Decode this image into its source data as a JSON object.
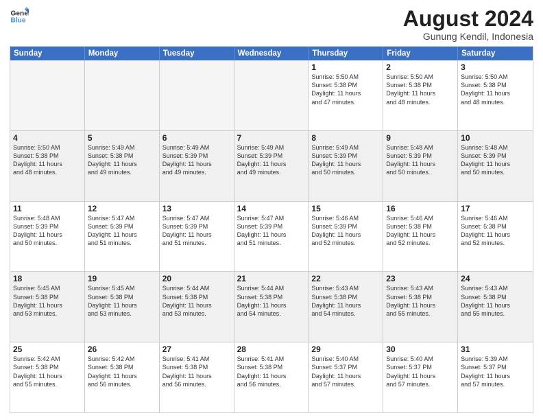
{
  "logo": {
    "line1": "General",
    "line2": "Blue"
  },
  "title": "August 2024",
  "location": "Gunung Kendil, Indonesia",
  "days_of_week": [
    "Sunday",
    "Monday",
    "Tuesday",
    "Wednesday",
    "Thursday",
    "Friday",
    "Saturday"
  ],
  "weeks": [
    [
      {
        "day": "",
        "info": "",
        "empty": true
      },
      {
        "day": "",
        "info": "",
        "empty": true
      },
      {
        "day": "",
        "info": "",
        "empty": true
      },
      {
        "day": "",
        "info": "",
        "empty": true
      },
      {
        "day": "1",
        "info": "Sunrise: 5:50 AM\nSunset: 5:38 PM\nDaylight: 11 hours\nand 47 minutes.",
        "empty": false
      },
      {
        "day": "2",
        "info": "Sunrise: 5:50 AM\nSunset: 5:38 PM\nDaylight: 11 hours\nand 48 minutes.",
        "empty": false
      },
      {
        "day": "3",
        "info": "Sunrise: 5:50 AM\nSunset: 5:38 PM\nDaylight: 11 hours\nand 48 minutes.",
        "empty": false
      }
    ],
    [
      {
        "day": "4",
        "info": "Sunrise: 5:50 AM\nSunset: 5:38 PM\nDaylight: 11 hours\nand 48 minutes.",
        "empty": false
      },
      {
        "day": "5",
        "info": "Sunrise: 5:49 AM\nSunset: 5:38 PM\nDaylight: 11 hours\nand 49 minutes.",
        "empty": false
      },
      {
        "day": "6",
        "info": "Sunrise: 5:49 AM\nSunset: 5:39 PM\nDaylight: 11 hours\nand 49 minutes.",
        "empty": false
      },
      {
        "day": "7",
        "info": "Sunrise: 5:49 AM\nSunset: 5:39 PM\nDaylight: 11 hours\nand 49 minutes.",
        "empty": false
      },
      {
        "day": "8",
        "info": "Sunrise: 5:49 AM\nSunset: 5:39 PM\nDaylight: 11 hours\nand 50 minutes.",
        "empty": false
      },
      {
        "day": "9",
        "info": "Sunrise: 5:48 AM\nSunset: 5:39 PM\nDaylight: 11 hours\nand 50 minutes.",
        "empty": false
      },
      {
        "day": "10",
        "info": "Sunrise: 5:48 AM\nSunset: 5:39 PM\nDaylight: 11 hours\nand 50 minutes.",
        "empty": false
      }
    ],
    [
      {
        "day": "11",
        "info": "Sunrise: 5:48 AM\nSunset: 5:39 PM\nDaylight: 11 hours\nand 50 minutes.",
        "empty": false
      },
      {
        "day": "12",
        "info": "Sunrise: 5:47 AM\nSunset: 5:39 PM\nDaylight: 11 hours\nand 51 minutes.",
        "empty": false
      },
      {
        "day": "13",
        "info": "Sunrise: 5:47 AM\nSunset: 5:39 PM\nDaylight: 11 hours\nand 51 minutes.",
        "empty": false
      },
      {
        "day": "14",
        "info": "Sunrise: 5:47 AM\nSunset: 5:39 PM\nDaylight: 11 hours\nand 51 minutes.",
        "empty": false
      },
      {
        "day": "15",
        "info": "Sunrise: 5:46 AM\nSunset: 5:39 PM\nDaylight: 11 hours\nand 52 minutes.",
        "empty": false
      },
      {
        "day": "16",
        "info": "Sunrise: 5:46 AM\nSunset: 5:38 PM\nDaylight: 11 hours\nand 52 minutes.",
        "empty": false
      },
      {
        "day": "17",
        "info": "Sunrise: 5:46 AM\nSunset: 5:38 PM\nDaylight: 11 hours\nand 52 minutes.",
        "empty": false
      }
    ],
    [
      {
        "day": "18",
        "info": "Sunrise: 5:45 AM\nSunset: 5:38 PM\nDaylight: 11 hours\nand 53 minutes.",
        "empty": false
      },
      {
        "day": "19",
        "info": "Sunrise: 5:45 AM\nSunset: 5:38 PM\nDaylight: 11 hours\nand 53 minutes.",
        "empty": false
      },
      {
        "day": "20",
        "info": "Sunrise: 5:44 AM\nSunset: 5:38 PM\nDaylight: 11 hours\nand 53 minutes.",
        "empty": false
      },
      {
        "day": "21",
        "info": "Sunrise: 5:44 AM\nSunset: 5:38 PM\nDaylight: 11 hours\nand 54 minutes.",
        "empty": false
      },
      {
        "day": "22",
        "info": "Sunrise: 5:43 AM\nSunset: 5:38 PM\nDaylight: 11 hours\nand 54 minutes.",
        "empty": false
      },
      {
        "day": "23",
        "info": "Sunrise: 5:43 AM\nSunset: 5:38 PM\nDaylight: 11 hours\nand 55 minutes.",
        "empty": false
      },
      {
        "day": "24",
        "info": "Sunrise: 5:43 AM\nSunset: 5:38 PM\nDaylight: 11 hours\nand 55 minutes.",
        "empty": false
      }
    ],
    [
      {
        "day": "25",
        "info": "Sunrise: 5:42 AM\nSunset: 5:38 PM\nDaylight: 11 hours\nand 55 minutes.",
        "empty": false
      },
      {
        "day": "26",
        "info": "Sunrise: 5:42 AM\nSunset: 5:38 PM\nDaylight: 11 hours\nand 56 minutes.",
        "empty": false
      },
      {
        "day": "27",
        "info": "Sunrise: 5:41 AM\nSunset: 5:38 PM\nDaylight: 11 hours\nand 56 minutes.",
        "empty": false
      },
      {
        "day": "28",
        "info": "Sunrise: 5:41 AM\nSunset: 5:38 PM\nDaylight: 11 hours\nand 56 minutes.",
        "empty": false
      },
      {
        "day": "29",
        "info": "Sunrise: 5:40 AM\nSunset: 5:37 PM\nDaylight: 11 hours\nand 57 minutes.",
        "empty": false
      },
      {
        "day": "30",
        "info": "Sunrise: 5:40 AM\nSunset: 5:37 PM\nDaylight: 11 hours\nand 57 minutes.",
        "empty": false
      },
      {
        "day": "31",
        "info": "Sunrise: 5:39 AM\nSunset: 5:37 PM\nDaylight: 11 hours\nand 57 minutes.",
        "empty": false
      }
    ]
  ]
}
